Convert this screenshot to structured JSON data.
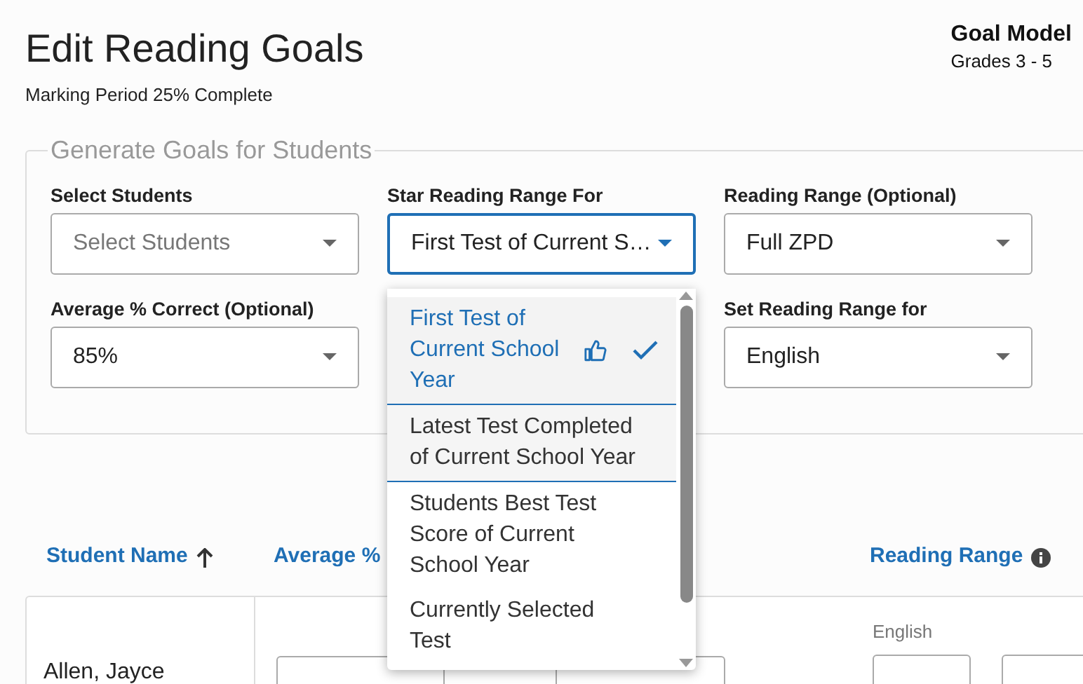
{
  "header": {
    "title": "Edit Reading Goals",
    "subtitle": "Marking Period 25% Complete",
    "model_label": "Goal Model",
    "model_value": "Grades 3 - 5"
  },
  "generate_panel": {
    "legend": "Generate Goals for Students",
    "fields": [
      {
        "label": "Select Students",
        "placeholder": "Select Students",
        "focused": false
      },
      {
        "label": "Star Reading Range For",
        "value": "First Test of Current S…",
        "focused": true
      },
      {
        "label": "Reading Range (Optional)",
        "value": "Full ZPD",
        "focused": false
      },
      {
        "label": "Average % Correct (Optional)",
        "value": "85%",
        "focused": false
      },
      {
        "label": "Set Reading Range for",
        "value": "English",
        "focused": false
      }
    ]
  },
  "dropdown": {
    "options": [
      {
        "label": "First Test of Current School Year",
        "selected": true,
        "recommended": true,
        "hovered": false
      },
      {
        "label": "Latest Test Completed of Current School Year",
        "selected": false,
        "recommended": false,
        "hovered": true
      },
      {
        "label": "Students Best Test Score of Current School Year",
        "selected": false,
        "recommended": false,
        "hovered": false
      },
      {
        "label": "Currently Selected Test",
        "selected": false,
        "recommended": false,
        "hovered": false
      }
    ]
  },
  "table": {
    "columns": [
      {
        "label": "Student Name",
        "sorted": true
      },
      {
        "label": "Average %"
      },
      {
        "label": "Reading Range",
        "info": true
      }
    ],
    "rows": [
      {
        "name": "Allen, Jayce",
        "range_language": "English"
      }
    ]
  }
}
